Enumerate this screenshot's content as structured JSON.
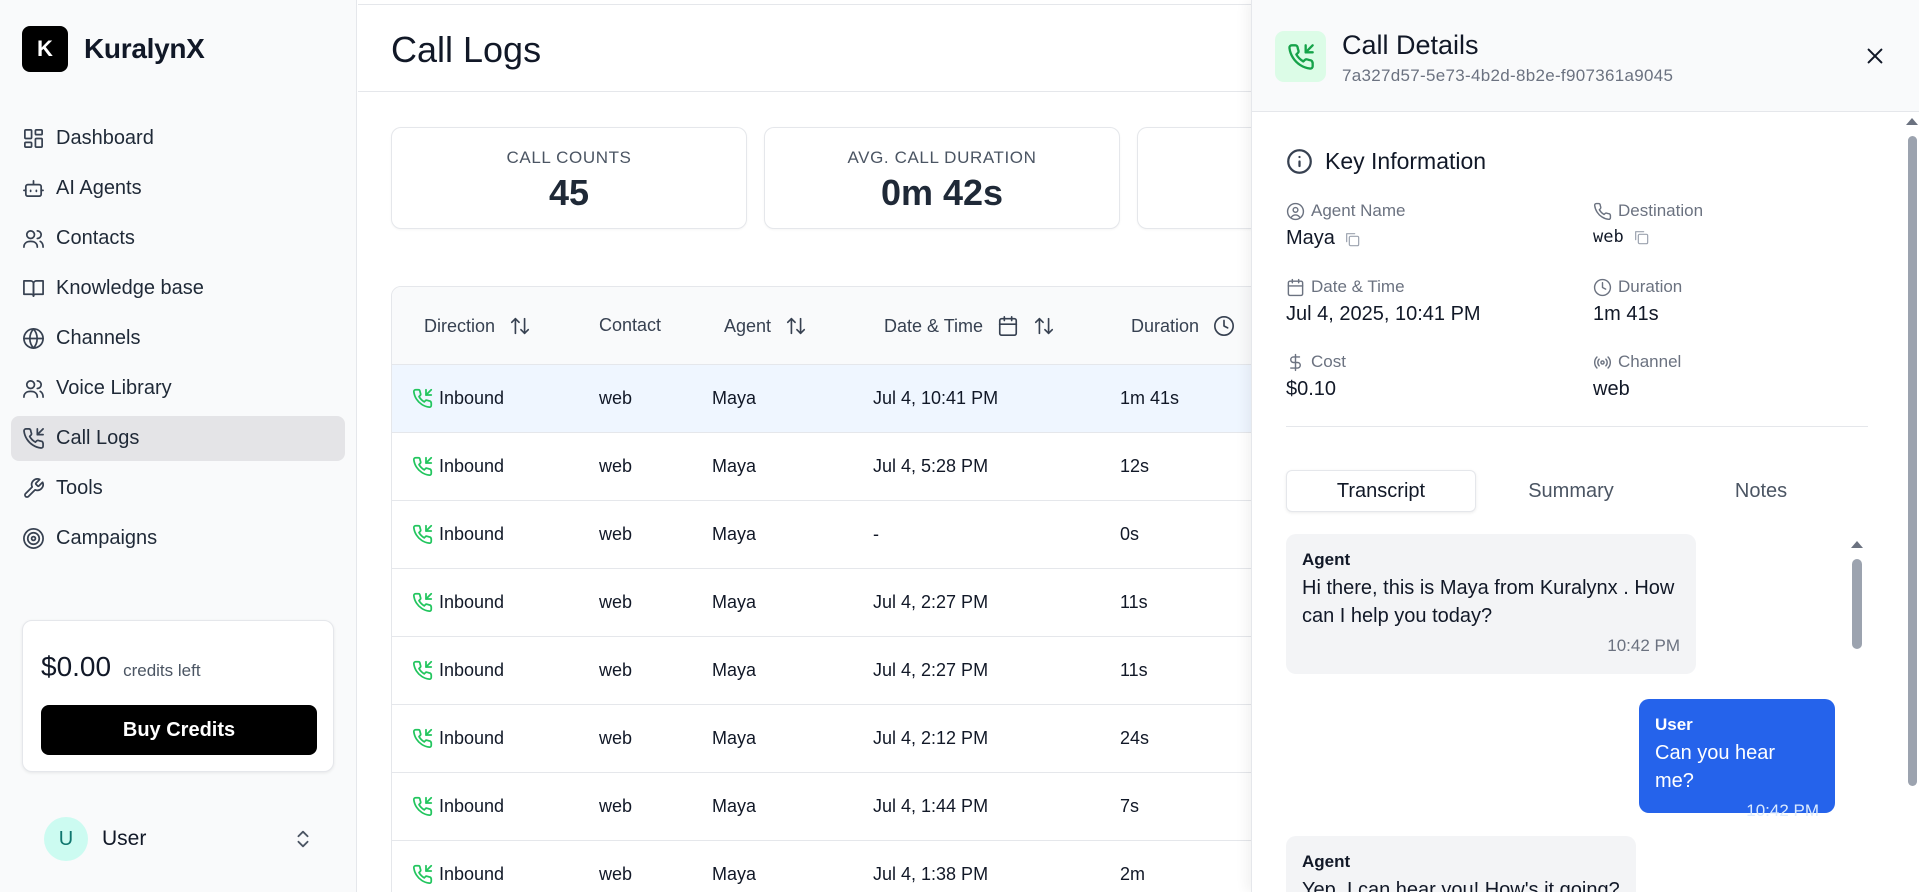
{
  "brand": {
    "logo_letter": "K",
    "name": "KuralynX"
  },
  "nav": [
    {
      "label": "Dashboard",
      "icon": "dashboard-icon"
    },
    {
      "label": "AI Agents",
      "icon": "bot-icon"
    },
    {
      "label": "Contacts",
      "icon": "users-icon"
    },
    {
      "label": "Knowledge base",
      "icon": "book-icon"
    },
    {
      "label": "Channels",
      "icon": "globe-icon"
    },
    {
      "label": "Voice Library",
      "icon": "users-icon"
    },
    {
      "label": "Call Logs",
      "icon": "phone-incoming-icon",
      "active": true
    },
    {
      "label": "Tools",
      "icon": "wrench-icon"
    },
    {
      "label": "Campaigns",
      "icon": "target-icon"
    }
  ],
  "credits": {
    "amount": "$0.00",
    "label": "credits left",
    "buy_label": "Buy Credits"
  },
  "user": {
    "initial": "U",
    "name": "User"
  },
  "page": {
    "title": "Call Logs"
  },
  "stats": [
    {
      "label": "CALL COUNTS",
      "value": "45"
    },
    {
      "label": "AVG. CALL DURATION",
      "value": "0m 42s"
    }
  ],
  "table": {
    "headers": {
      "direction": "Direction",
      "contact": "Contact",
      "agent": "Agent",
      "datetime": "Date & Time",
      "duration": "Duration"
    },
    "rows": [
      {
        "direction": "Inbound",
        "contact": "web",
        "agent": "Maya",
        "datetime": "Jul 4, 10:41 PM",
        "duration": "1m 41s"
      },
      {
        "direction": "Inbound",
        "contact": "web",
        "agent": "Maya",
        "datetime": "Jul 4, 5:28 PM",
        "duration": "12s"
      },
      {
        "direction": "Inbound",
        "contact": "web",
        "agent": "Maya",
        "datetime": "-",
        "duration": "0s"
      },
      {
        "direction": "Inbound",
        "contact": "web",
        "agent": "Maya",
        "datetime": "Jul 4, 2:27 PM",
        "duration": "11s"
      },
      {
        "direction": "Inbound",
        "contact": "web",
        "agent": "Maya",
        "datetime": "Jul 4, 2:27 PM",
        "duration": "11s"
      },
      {
        "direction": "Inbound",
        "contact": "web",
        "agent": "Maya",
        "datetime": "Jul 4, 2:12 PM",
        "duration": "24s"
      },
      {
        "direction": "Inbound",
        "contact": "web",
        "agent": "Maya",
        "datetime": "Jul 4, 1:44 PM",
        "duration": "7s"
      },
      {
        "direction": "Inbound",
        "contact": "web",
        "agent": "Maya",
        "datetime": "Jul 4, 1:38 PM",
        "duration": "2m"
      }
    ]
  },
  "details": {
    "title": "Call Details",
    "call_id": "7a327d57-5e73-4b2d-8b2e-f907361a9045",
    "key_info_title": "Key Information",
    "agent_name": {
      "label": "Agent Name",
      "value": "Maya"
    },
    "destination": {
      "label": "Destination",
      "value": "web"
    },
    "date_time": {
      "label": "Date & Time",
      "value": "Jul 4, 2025, 10:41 PM"
    },
    "duration": {
      "label": "Duration",
      "value": "1m 41s"
    },
    "cost": {
      "label": "Cost",
      "value": "$0.10"
    },
    "channel": {
      "label": "Channel",
      "value": "web"
    },
    "tabs": [
      "Transcript",
      "Summary",
      "Notes"
    ],
    "messages": [
      {
        "role": "Agent",
        "text": "Hi there, this is Maya from Kuralynx . How can I help you today?",
        "time": "10:42 PM"
      },
      {
        "role": "User",
        "text": "Can you hear me?",
        "time": "10:42 PM"
      },
      {
        "role": "Agent",
        "text": "Yep, I can hear you! How's it going?",
        "time": ""
      }
    ]
  },
  "colors": {
    "accent": "#2563eb",
    "inbound": "#22c55e",
    "active_nav": "#e4e4e7"
  }
}
